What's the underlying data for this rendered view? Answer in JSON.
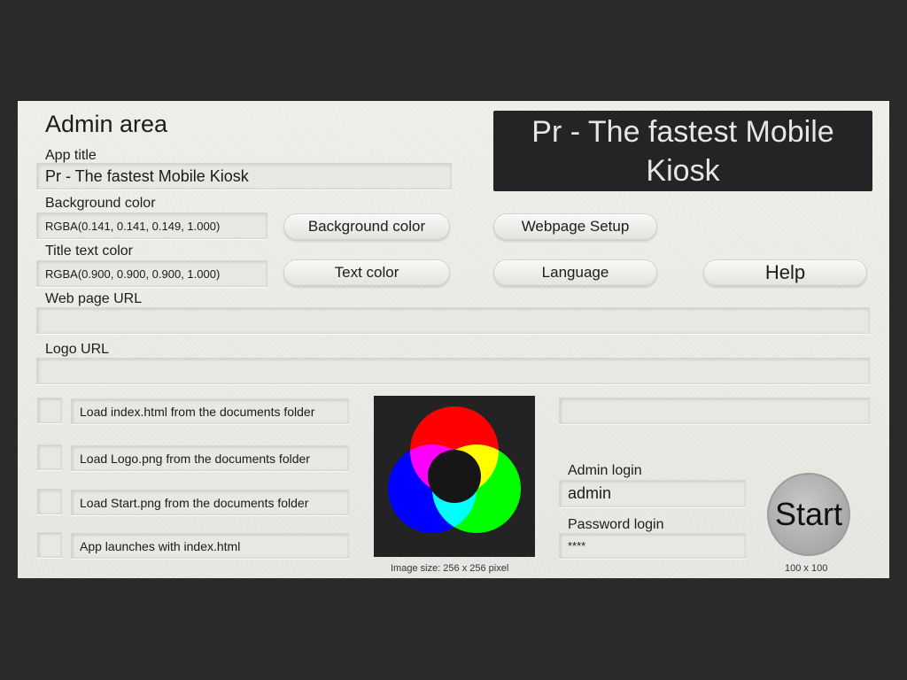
{
  "admin": {
    "heading": "Admin area"
  },
  "preview": {
    "title": "Pr - The fastest Mobile Kiosk"
  },
  "fields": {
    "app_title": {
      "label": "App title",
      "value": "Pr - The fastest Mobile Kiosk"
    },
    "background_color": {
      "label": "Background color",
      "value": "RGBA(0.141, 0.141, 0.149, 1.000)"
    },
    "title_text_color": {
      "label": "Title text color",
      "value": "RGBA(0.900, 0.900, 0.900, 1.000)"
    },
    "web_page_url": {
      "label": "Web page URL",
      "value": ""
    },
    "logo_url": {
      "label": "Logo URL",
      "value": ""
    },
    "extra": {
      "value": ""
    },
    "admin_login": {
      "label": "Admin login",
      "value": "admin"
    },
    "password_login": {
      "label": "Password login",
      "value": "****"
    }
  },
  "buttons": {
    "background_color": "Background color",
    "text_color": "Text color",
    "webpage_setup": "Webpage Setup",
    "language": "Language",
    "help": "Help",
    "start": "Start"
  },
  "options": [
    {
      "label": "Load index.html from the documents folder",
      "checked": false
    },
    {
      "label": "Load Logo.png from the documents folder",
      "checked": false
    },
    {
      "label": "Load Start.png from the documents folder",
      "checked": false
    },
    {
      "label": "App launches with index.html",
      "checked": false
    }
  ],
  "logo": {
    "caption": "Image size: 256 x 256 pixel"
  },
  "start_size": "100 x 100",
  "colors": {
    "preview_bg": "#242426",
    "preview_text": "#e6e6e6",
    "panel_bg": "#eeece9"
  }
}
